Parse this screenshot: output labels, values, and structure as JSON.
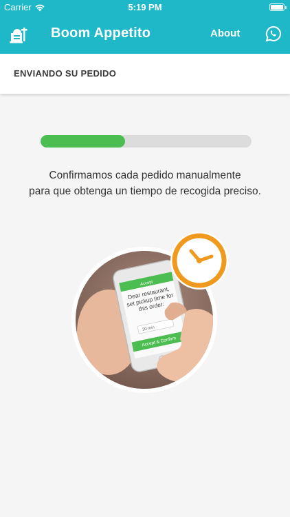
{
  "status_bar": {
    "carrier": "Carrier",
    "time": "5:19 PM"
  },
  "nav": {
    "title": "Boom Appetito",
    "about_label": "About",
    "logo_icon": "food-delivery-icon",
    "whatsapp_icon": "whatsapp-icon"
  },
  "subheader": {
    "label": "ENVIANDO SU PEDIDO"
  },
  "progress": {
    "value": 0.4
  },
  "message": {
    "line1": "Confirmamos cada pedido manualmente",
    "line2": "para que obtenga un tiempo de recogida preciso."
  },
  "illustration": {
    "phone_screen_header": "Accept",
    "phone_screen_text": "Dear restaurant, set pickup time for this order:",
    "phone_screen_input": "30 min",
    "phone_screen_button": "Accept & Confirm"
  },
  "colors": {
    "primary": "#1eb8c9",
    "progress_fill": "#4cbd51",
    "clock": "#ef9a1e"
  }
}
